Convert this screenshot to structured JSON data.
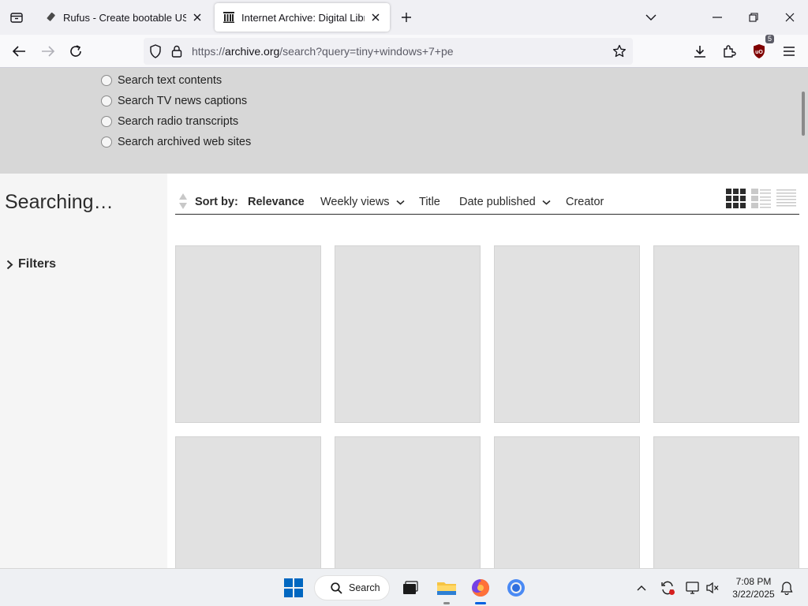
{
  "browser": {
    "tabs": [
      {
        "title": "Rufus - Create bootable USB drives the easy way",
        "active": false,
        "favicon": "usb-drive-icon"
      },
      {
        "title": "Internet Archive: Digital Library of Free & Borrowable Books",
        "active": true,
        "favicon": "archive-building-icon"
      }
    ],
    "url": {
      "prefix": "https://",
      "host": "archive.org",
      "path": "/search?query=tiny+windows+7+pe"
    },
    "extension_badge": "5",
    "accent_color": "#0061e0"
  },
  "search_options": [
    "Search text contents",
    "Search TV news captions",
    "Search radio transcripts",
    "Search archived web sites"
  ],
  "status_text": "Searching…",
  "filters_label": "Filters",
  "sort": {
    "label": "Sort by:",
    "options": [
      "Relevance",
      "Weekly views",
      "Title",
      "Date published",
      "Creator"
    ],
    "selected": "Relevance"
  },
  "view_modes": [
    "tile-view-icon",
    "list-detail-view-icon",
    "list-compact-view-icon"
  ],
  "taskbar": {
    "search_label": "Search",
    "time": "7:08 PM",
    "date": "3/22/2025"
  }
}
